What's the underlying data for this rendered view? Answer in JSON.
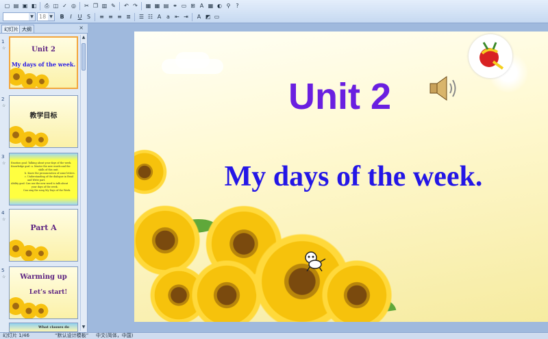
{
  "toolbar": {
    "font_name": "",
    "font_size": "18"
  },
  "pane": {
    "tabs": [
      "幻灯片",
      "大纲"
    ],
    "close_label": "×"
  },
  "thumbnails": [
    {
      "num": "1",
      "title": "Unit 2",
      "line2": "My days of the week."
    },
    {
      "num": "2",
      "title": "教学目标"
    },
    {
      "num": "3",
      "lines": [
        "Emotion goal: Talking about your days of the week.",
        "Knowledge goal: a. Master the new words and the",
        "skills of this unit.",
        "b. Know the pronunciation of some letters.",
        "c. Understanding of the dialogue in Read",
        "and Write part.",
        "Ability goal: Can use the new word to talk about",
        "your days of the week.",
        "Can sing the song My Days of the Week."
      ]
    },
    {
      "num": "4",
      "title": "Part A"
    },
    {
      "num": "5",
      "title": "Warming up",
      "line2": "Let’s start!"
    },
    {
      "num": "6",
      "title": "What classes do"
    }
  ],
  "slide": {
    "title": "Unit 2",
    "subtitle": "My days of the week."
  },
  "status": {
    "slide_pos": "幻灯片 1/46",
    "theme": "“默认设计模板”",
    "language": "中文(简体，中国)"
  },
  "colors": {
    "title": "#6a1fe0",
    "subtitle": "#2416e6",
    "thumb_title": "#5a1f80"
  }
}
